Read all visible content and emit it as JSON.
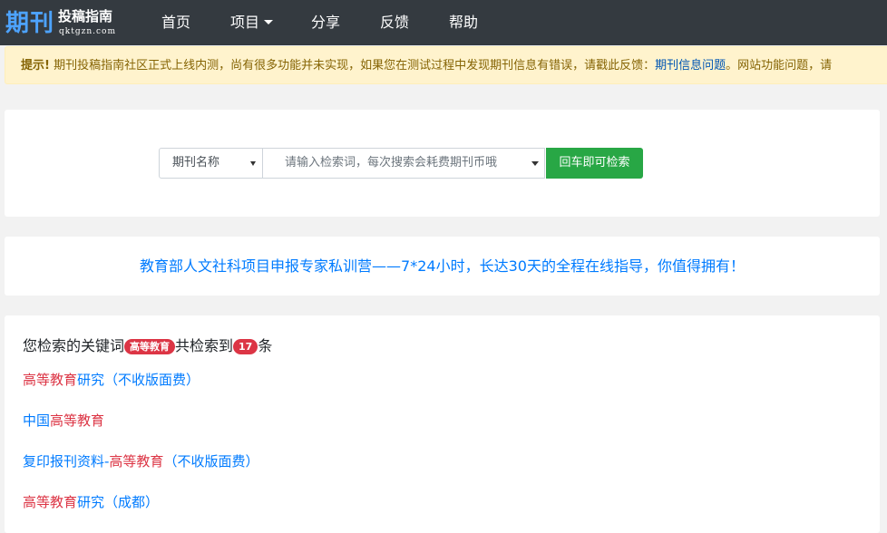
{
  "navbar": {
    "logo_big": "期刊",
    "logo_cn": "投稿指南",
    "logo_en": "qktgzn.com",
    "items": [
      {
        "label": "首页"
      },
      {
        "label": "项目"
      },
      {
        "label": "分享"
      },
      {
        "label": "反馈"
      },
      {
        "label": "帮助"
      }
    ]
  },
  "alert": {
    "prefix": "提示!",
    "text": " 期刊投稿指南社区正式上线内测，尚有很多功能并未实现，如果您在测试过程中发现期刊信息有错误，请戳此反馈：",
    "link": "期刊信息问题",
    "suffix": "。网站功能问题，请"
  },
  "search": {
    "select_value": "期刊名称",
    "input_placeholder": "请输入检索词，每次搜索会耗费期刊币哦",
    "button_label": "回车即可检索"
  },
  "banner": {
    "text": "教育部人文社科项目申报专家私训营——7*24小时，长达30天的全程在线指导，你值得拥有！"
  },
  "results": {
    "summary_prefix": "您检索的关键词",
    "keyword": "高等教育",
    "summary_mid": "共检索到",
    "count": "17",
    "summary_suffix": "条",
    "items": [
      {
        "pre": "",
        "hl": "高等教育",
        "post": "研究（不收版面费）"
      },
      {
        "pre": "中国",
        "hl": "高等教育",
        "post": ""
      },
      {
        "pre": "复印报刊资料-",
        "hl": "高等教育",
        "post": "（不收版面费）"
      },
      {
        "pre": "",
        "hl": "高等教育",
        "post": "研究（成都）"
      }
    ]
  },
  "colors": {
    "navbar_bg": "#343a40",
    "accent": "#007bff",
    "highlight": "#dc3545",
    "button": "#28a745",
    "alert_bg": "#fff3cd"
  }
}
